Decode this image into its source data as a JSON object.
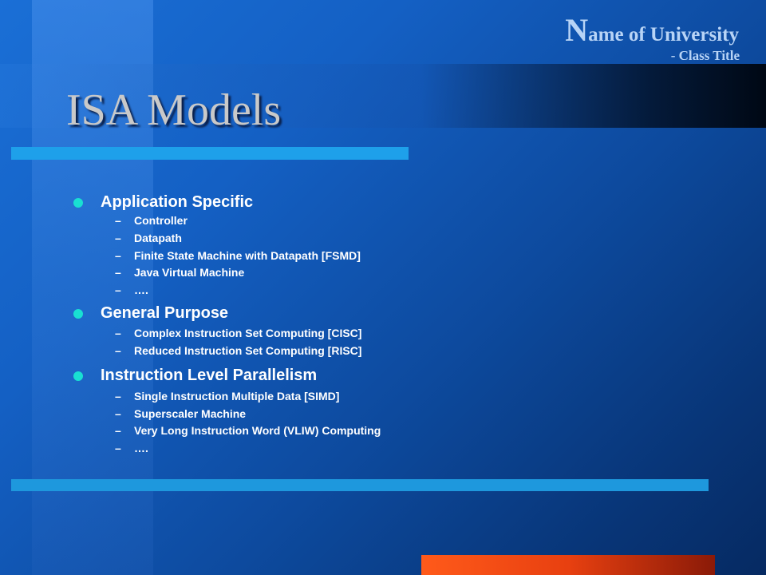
{
  "header": {
    "university_initial": "N",
    "university_rest": "ame of University",
    "class_title": "- Class Title"
  },
  "slide": {
    "title": "ISA Models"
  },
  "sections": [
    {
      "heading": "Application Specific",
      "items": [
        "Controller",
        "Datapath",
        "Finite State Machine with Datapath [FSMD]",
        "Java Virtual Machine",
        "…."
      ]
    },
    {
      "heading": "General Purpose",
      "items": [
        "Complex Instruction Set Computing [CISC]",
        "Reduced Instruction Set Computing [RISC]"
      ]
    },
    {
      "heading": "Instruction Level Parallelism",
      "items": [
        "Single Instruction Multiple Data [SIMD]",
        "Superscaler Machine",
        "Very Long Instruction Word (VLIW) Computing",
        "…."
      ]
    }
  ],
  "sub_marker": "–",
  "colors": {
    "bullet": "#19e0d2",
    "accent_bar": "#1ea0ea",
    "orange": "#ff5a1a"
  }
}
